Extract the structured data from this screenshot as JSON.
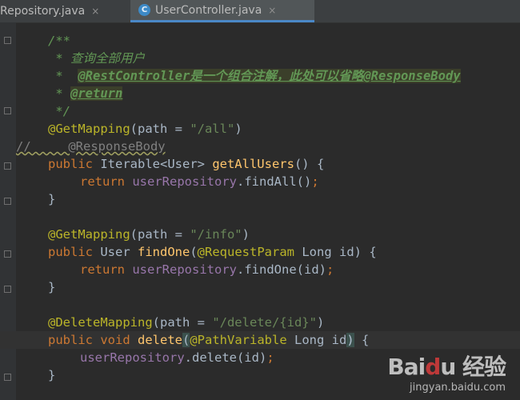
{
  "tabs": [
    {
      "label": "Repository.java",
      "close": "×",
      "active": false
    },
    {
      "label": "UserController.java",
      "close": "×",
      "active": true,
      "icon": "java-class-icon",
      "icon_text": "C"
    }
  ],
  "code": {
    "l1": "/**",
    "l2": " * 查询全部用户",
    "l3a": " *  ",
    "l3b": "@RestController是一个组合注解，此处可以省略@ResponseBody",
    "l4a": " * ",
    "l4b": "@return",
    "l5": " */",
    "getmap_ann": "@GetMapping",
    "getmap_rest": "(path = ",
    "getmap_path": "\"/all\"",
    "close_paren": ")",
    "commented": "//     @ResponseBody",
    "public": "public",
    "iterable": " Iterable<User> ",
    "getAllUsers": "getAllUsers",
    "getAll_rest": "() {",
    "return": "return",
    "userRepository": "userRepository",
    "findAll": ".findAll()",
    "semi": ";",
    "rbrace": "}",
    "info_path": "\"/info\"",
    "user_type": " User ",
    "findOne": "findOne",
    "open_paren": "(",
    "request_param": "@RequestParam",
    "long_id": " Long id) {",
    "findOne_call": ".findOne(id)",
    "delete_ann": "@DeleteMapping",
    "delete_path": "\"/delete/{id}\"",
    "void": " void ",
    "delete": "delete",
    "path_variable": "@PathVariable",
    "long_id2": " Long id",
    "paren_brace": ") {",
    "delete_call": ".delete(id)"
  },
  "watermark": {
    "logo_a": "Bai",
    "logo_paw": "d",
    "logo_b": "u 经验",
    "url": "jingyan.baidu.com"
  },
  "colors": {
    "background": "#2b2b2b",
    "keyword": "#cc7832",
    "annotation": "#bbb529",
    "string": "#6a8759",
    "field": "#9876aa",
    "method": "#ffc66d"
  }
}
